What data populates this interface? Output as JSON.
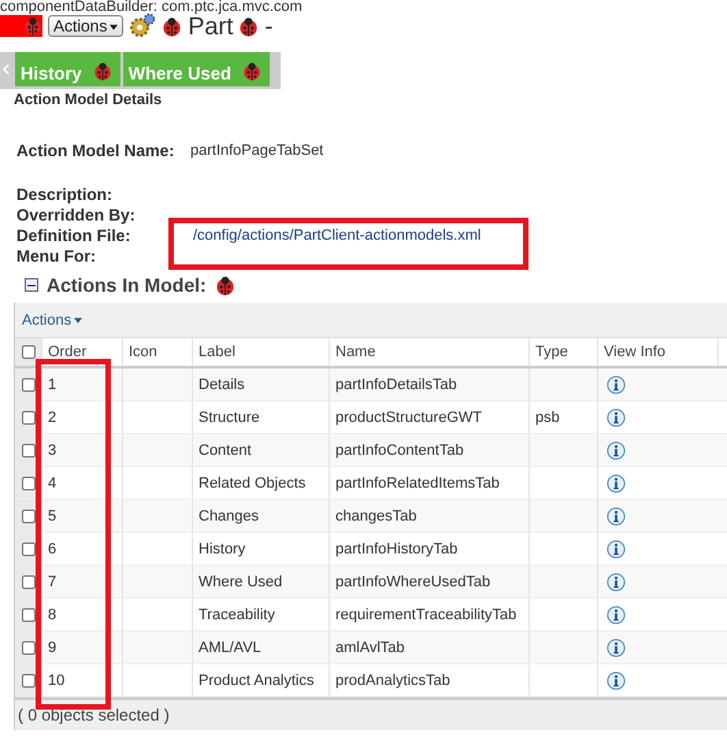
{
  "top_line": "componentDataBuilder: com.ptc.jca.mvc.com",
  "header": {
    "actions_button": "Actions",
    "title": "Part",
    "suffix": "-"
  },
  "tabs": [
    {
      "label": "History"
    },
    {
      "label": "Where Used"
    }
  ],
  "section_title": "Action Model Details",
  "details": {
    "name_label": "Action Model Name:",
    "name_value": "partInfoPageTabSet",
    "fields": [
      {
        "label": "Description:"
      },
      {
        "label": "Overridden By:"
      },
      {
        "label": "Definition File:",
        "value": "/config/actions/PartClient-actionmodels.xml"
      },
      {
        "label": "Menu For:"
      }
    ]
  },
  "actions_section": {
    "title": "Actions In Model:",
    "expanded": true
  },
  "table": {
    "actions_menu": "Actions",
    "header_checked": false,
    "columns": [
      "Order",
      "Icon",
      "Label",
      "Name",
      "Type",
      "View Info"
    ],
    "rows": [
      {
        "checked": false,
        "order": "1",
        "label": "Details",
        "name": "partInfoDetailsTab"
      },
      {
        "checked": false,
        "order": "2",
        "label": "Structure",
        "name": "productStructureGWT",
        "type": "psb"
      },
      {
        "checked": false,
        "order": "3",
        "label": "Content",
        "name": "partInfoContentTab"
      },
      {
        "checked": false,
        "order": "4",
        "label": "Related Objects",
        "name": "partInfoRelatedItemsTab"
      },
      {
        "checked": false,
        "order": "5",
        "label": "Changes",
        "name": "changesTab"
      },
      {
        "checked": false,
        "order": "6",
        "label": "History",
        "name": "partInfoHistoryTab"
      },
      {
        "checked": false,
        "order": "7",
        "label": "Where Used",
        "name": "partInfoWhereUsedTab"
      },
      {
        "checked": false,
        "order": "8",
        "label": "Traceability",
        "name": "requirementTraceabilityTab"
      },
      {
        "checked": false,
        "order": "9",
        "label": "AML/AVL",
        "name": "amlAvlTab"
      },
      {
        "checked": false,
        "order": "10",
        "label": "Product Analytics",
        "name": "prodAnalyticsTab"
      }
    ],
    "footer": "( 0 objects selected )"
  }
}
